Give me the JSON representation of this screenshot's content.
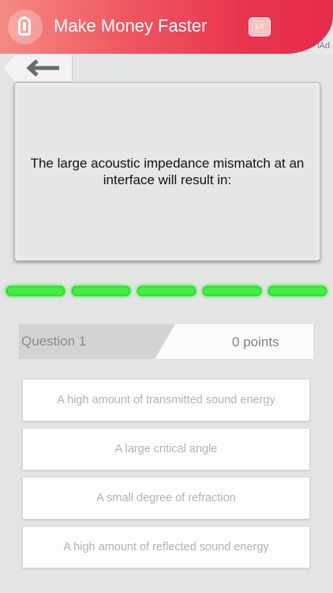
{
  "ad": {
    "title": "Make Money Faster",
    "cta_label": "Le",
    "provider_label": "iAd"
  },
  "navigation": {
    "back_icon": "back-arrow-icon"
  },
  "question": {
    "text": "The large acoustic impedance mismatch at an interface will result in:"
  },
  "progress": {
    "total_segments": 5,
    "segment_color": "#44ee44"
  },
  "status": {
    "question_label": "Question 1",
    "points_value": "0",
    "points_unit": "points"
  },
  "answers": [
    "A high amount of transmitted sound energy",
    "A large critical angle",
    "A small degree of refraction",
    "A high amount of reflected sound energy"
  ],
  "colors": {
    "ad_brand": "#e8334e",
    "progress_green": "#44ee44",
    "background": "#e4e4e4"
  }
}
